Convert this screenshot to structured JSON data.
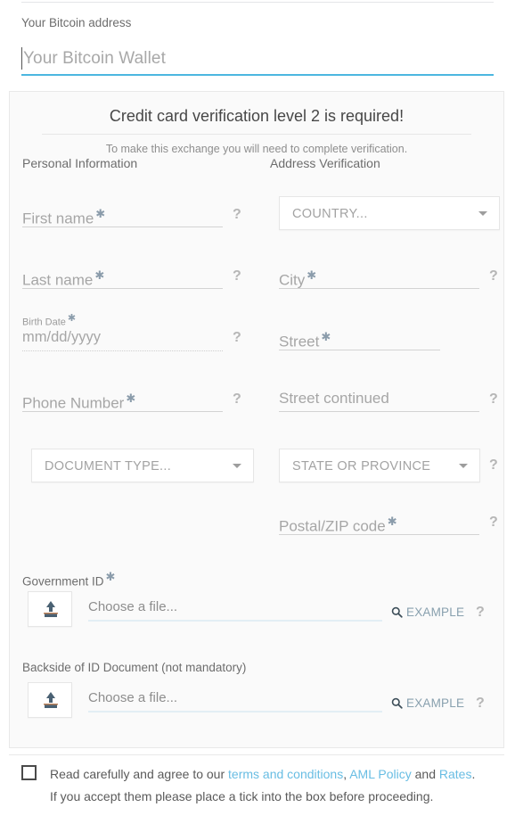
{
  "bitcoin": {
    "label": "Your Bitcoin address",
    "placeholder": "Your Bitcoin Wallet",
    "value": "",
    "accent_color": "#4cb7e0"
  },
  "panel": {
    "title": "Credit card verification level 2 is required!",
    "subtitle": "To make this exchange you will need to complete verification.",
    "background_color": "#fafafa"
  },
  "personal": {
    "heading": "Personal Information",
    "fields": [
      {
        "name": "first-name",
        "placeholder": "First name",
        "required": true,
        "help": "?",
        "kind": "text"
      },
      {
        "name": "last-name",
        "placeholder": "Last name",
        "required": true,
        "help": "?",
        "kind": "text"
      },
      {
        "name": "birth-date",
        "placeholder": "mm/dd/yyyy",
        "float_label": "Birth Date",
        "required": true,
        "help": "?",
        "kind": "date"
      },
      {
        "name": "phone-number",
        "placeholder": "Phone Number",
        "required": true,
        "help": "?",
        "kind": "text"
      }
    ],
    "document_type": {
      "name": "document-type",
      "value": "DOCUMENT TYPE...",
      "kind": "select"
    }
  },
  "address": {
    "heading": "Address Verification",
    "country": {
      "name": "country",
      "value": "COUNTRY...",
      "kind": "select"
    },
    "fields": [
      {
        "name": "city",
        "placeholder": "City",
        "required": true,
        "help": "?",
        "kind": "text"
      },
      {
        "name": "street",
        "placeholder": "Street",
        "required": true,
        "help": "",
        "kind": "text"
      },
      {
        "name": "street-continued",
        "placeholder": "Street continued",
        "required": false,
        "help": "?",
        "kind": "text"
      }
    ],
    "state": {
      "name": "state-or-province",
      "value": "STATE OR PROVINCE",
      "help": "?",
      "kind": "select"
    },
    "postal": {
      "name": "postal-zip-code",
      "placeholder": "Postal/ZIP code",
      "required": true,
      "help": "?",
      "kind": "text"
    }
  },
  "uploads": [
    {
      "name": "government-id",
      "label": "Government ID",
      "required": true,
      "file_placeholder": "Choose a file...",
      "example_label": "EXAMPLE",
      "help": "?"
    },
    {
      "name": "backside-of-id",
      "label": "Backside of ID Document (not mandatory)",
      "required": false,
      "file_placeholder": "Choose a file...",
      "example_label": "EXAMPLE",
      "help": "?"
    }
  ],
  "agreement": {
    "checked": false,
    "part1": "Read carefully and agree to our ",
    "link1": "terms and conditions",
    "sep1": ", ",
    "link2": "AML Policy",
    "sep2": " and ",
    "link3": "Rates",
    "part2": ". If you accept them please place a tick into the box before proceeding.",
    "link_color": "#68bde3"
  }
}
